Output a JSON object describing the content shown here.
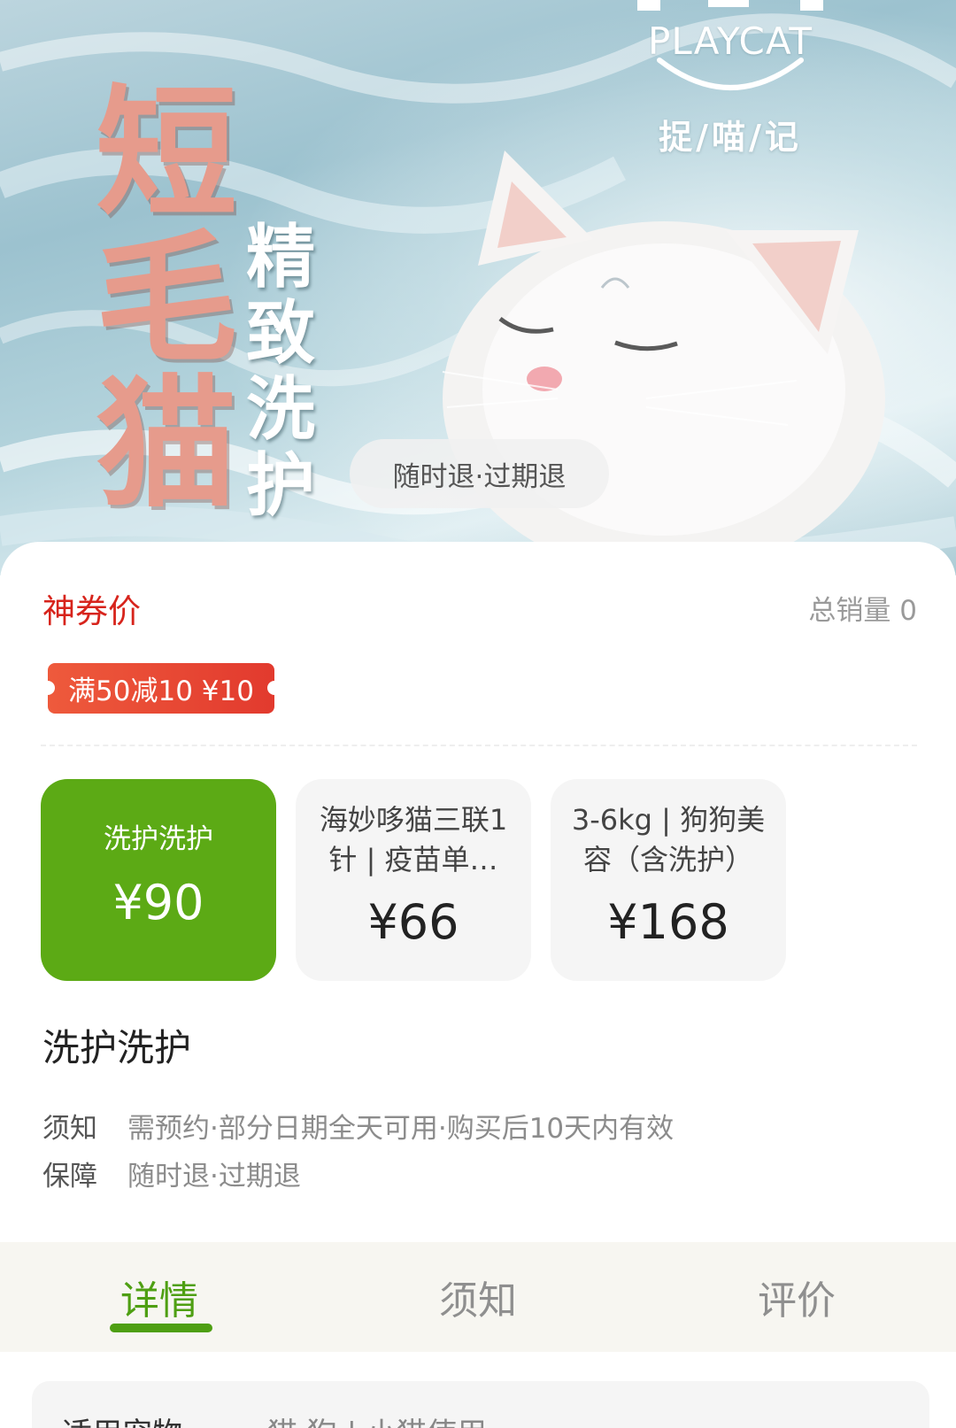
{
  "hero": {
    "brand_name": "PLAYCAT",
    "brand_sub": "捉/喵/记",
    "title_chars": [
      "短",
      "毛",
      "猫"
    ],
    "subtitle_chars": [
      "精",
      "致",
      "洗",
      "护"
    ],
    "refund_chip": "随时退·过期退"
  },
  "price": {
    "label": "神券价",
    "sales": "总销量 0",
    "coupon": "满50减10 ¥10"
  },
  "options": [
    {
      "name": "洗护洗护",
      "price": "¥90",
      "selected": true
    },
    {
      "name": "海妙哆猫三联1针 | 疫苗单…",
      "price": "¥66",
      "selected": false
    },
    {
      "name": "3-6kg | 狗狗美容（含洗护）",
      "price": "¥168",
      "selected": false
    }
  ],
  "product": {
    "name": "洗护洗护",
    "notice_label": "须知",
    "notice_value": "需预约·部分日期全天可用·购买后10天内有效",
    "guarantee_label": "保障",
    "guarantee_value": "随时退·过期退"
  },
  "tabs": [
    {
      "label": "详情",
      "active": true
    },
    {
      "label": "须知",
      "active": false
    },
    {
      "label": "评价",
      "active": false
    }
  ],
  "details": {
    "pet_label": "适用宠物",
    "pet_value": "猫·狗 | 小猫使用"
  },
  "colors": {
    "accent_green": "#5caa15",
    "price_red": "#d7241c",
    "coupon_red": "#e23a2e",
    "title_pink": "#e69b8c"
  }
}
